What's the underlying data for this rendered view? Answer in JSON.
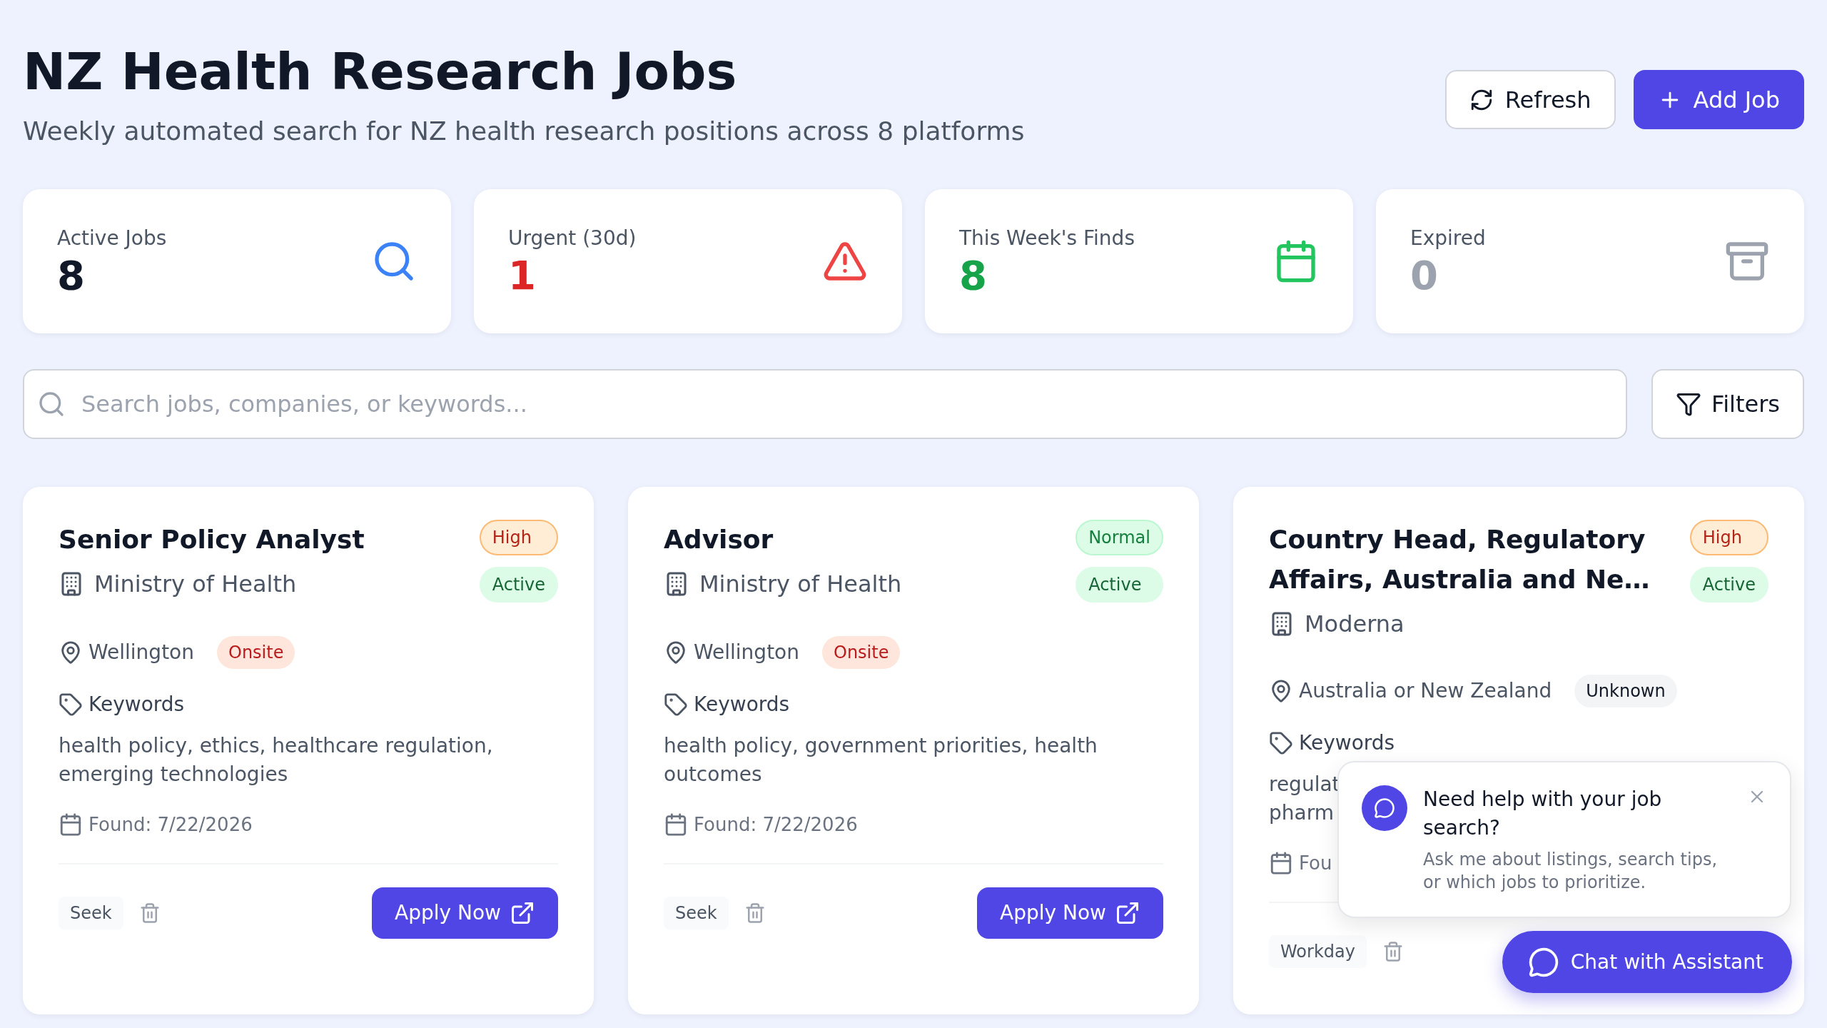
{
  "header": {
    "title": "NZ Health Research Jobs",
    "subtitle": "Weekly automated search for NZ health research positions across 8 platforms",
    "buttons": [
      {
        "label": "Refresh",
        "kind": "secondary"
      },
      {
        "label": "Add Job",
        "kind": "primary"
      }
    ]
  },
  "stats": [
    {
      "label": "Active Jobs",
      "value": "8",
      "kind": "active",
      "color": "#111827"
    },
    {
      "label": "Urgent (30d)",
      "value": "1",
      "kind": "urgent",
      "color": "#dc2626"
    },
    {
      "label": "This Week's Finds",
      "value": "8",
      "kind": "recent",
      "color": "#16a34a"
    },
    {
      "label": "Expired",
      "value": "0",
      "kind": "expired",
      "color": "#9ca3af"
    }
  ],
  "search": {
    "placeholder": "Search jobs, companies, or keywords...",
    "filters_label": "Filters"
  },
  "jobs": [
    {
      "title": "Senior Policy Analyst",
      "company": "Ministry of Health",
      "badges": [
        {
          "text": "High",
          "kind": "high"
        },
        {
          "text": "Active",
          "kind": "active"
        }
      ],
      "location": "Wellington",
      "work_mode": {
        "text": "Onsite",
        "kind": "onsite"
      },
      "keywords_label": "Keywords",
      "keywords": "health policy, ethics, healthcare regulation, emerging technologies",
      "found": "Found: 7/22/2026",
      "source": "Seek",
      "apply": "Apply Now"
    },
    {
      "title": "Advisor",
      "company": "Ministry of Health",
      "badges": [
        {
          "text": "Normal",
          "kind": "normal"
        },
        {
          "text": "Active",
          "kind": "active"
        }
      ],
      "location": "Wellington",
      "work_mode": {
        "text": "Onsite",
        "kind": "onsite"
      },
      "keywords_label": "Keywords",
      "keywords": "health policy, government priorities, health outcomes",
      "found": "Found: 7/22/2026",
      "source": "Seek",
      "apply": "Apply Now"
    },
    {
      "title": "Country Head, Regulatory Affairs, Australia and Ne…",
      "company": "Moderna",
      "badges": [
        {
          "text": "High",
          "kind": "high"
        },
        {
          "text": "Active",
          "kind": "active"
        }
      ],
      "location": "Australia or New Zealand",
      "work_mode": {
        "text": "Unknown",
        "kind": "unknown"
      },
      "keywords_label": "Keywords",
      "keywords": "regulat\npharm",
      "found": "Fou",
      "source": "Workday"
    }
  ],
  "assistant": {
    "title": "Need help with your job search?",
    "text": "Ask me about listings, search tips, or which jobs to prioritize.",
    "button_label": "Chat with Assistant"
  }
}
